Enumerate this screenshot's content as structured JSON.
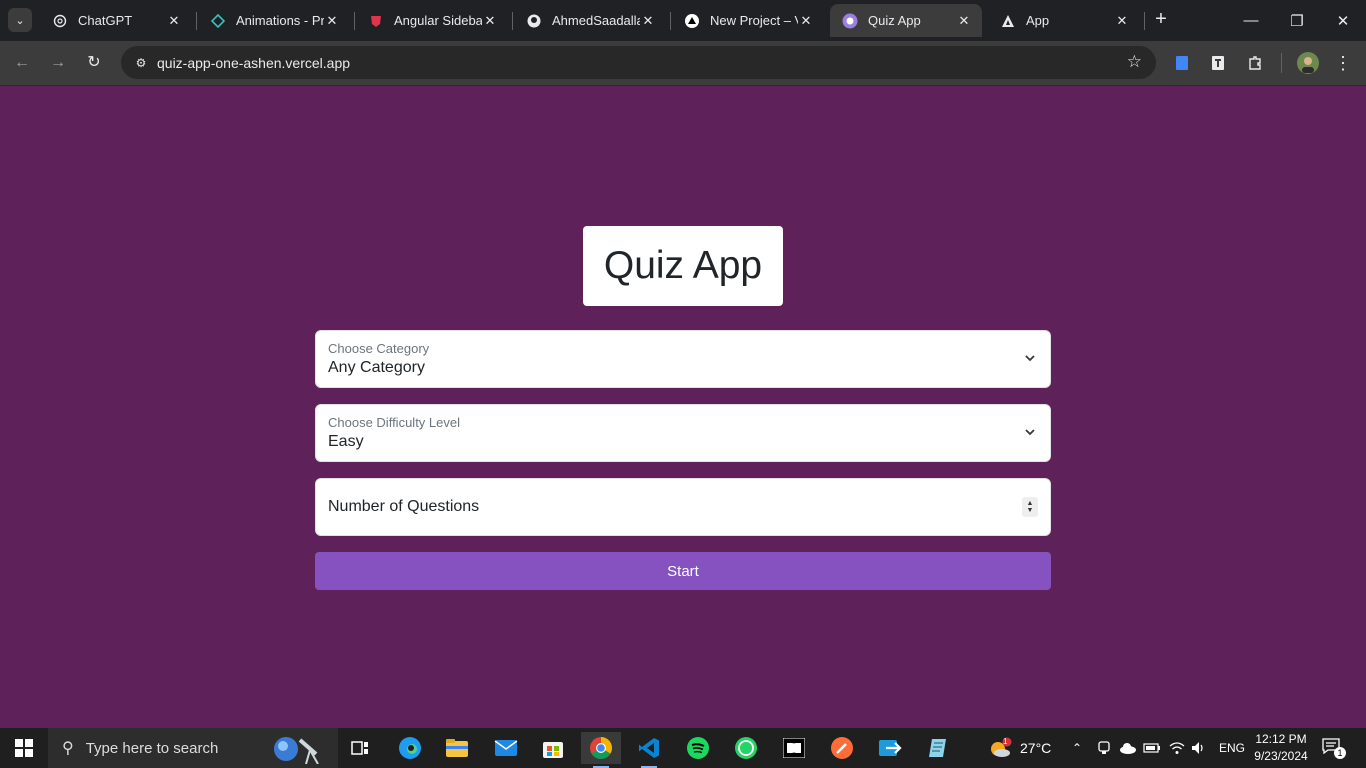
{
  "browser": {
    "tabs": [
      {
        "title": "ChatGPT",
        "favicon": "chatgpt-icon"
      },
      {
        "title": "Animations - Pri",
        "favicon": "primeng-icon"
      },
      {
        "title": "Angular Sidebar",
        "favicon": "brave-shield-icon"
      },
      {
        "title": "AhmedSaadallah",
        "favicon": "github-icon"
      },
      {
        "title": "New Project – Ve",
        "favicon": "vercel-icon"
      },
      {
        "title": "Quiz App",
        "favicon": "quiz-app-icon",
        "active": true
      },
      {
        "title": "App",
        "favicon": "angular-icon"
      }
    ],
    "url": "quiz-app-one-ashen.vercel.app"
  },
  "quiz": {
    "title": "Quiz App",
    "category_label": "Choose Category",
    "category_value": "Any Category",
    "difficulty_label": "Choose Difficulty Level",
    "difficulty_value": "Easy",
    "questions_placeholder": "Number of Questions",
    "start_label": "Start"
  },
  "taskbar": {
    "search_placeholder": "Type here to search",
    "weather": "27°C",
    "weather_badge": "1",
    "language": "ENG",
    "time": "12:12 PM",
    "date": "9/23/2024",
    "notification_count": "1",
    "apps": [
      "task-view-icon",
      "edge-icon",
      "file-explorer-icon",
      "mail-icon",
      "store-icon",
      "chrome-icon",
      "vscode-icon",
      "spotify-icon",
      "whatsapp-icon",
      "dolby-icon",
      "postman-icon",
      "send-icon",
      "notepad-icon"
    ]
  },
  "colors": {
    "page_bg": "#5e2159",
    "start_button": "#8552c0",
    "browser_dark": "#202124",
    "toolbar": "#3c3c3c",
    "taskbar": "#1f1f1f"
  }
}
